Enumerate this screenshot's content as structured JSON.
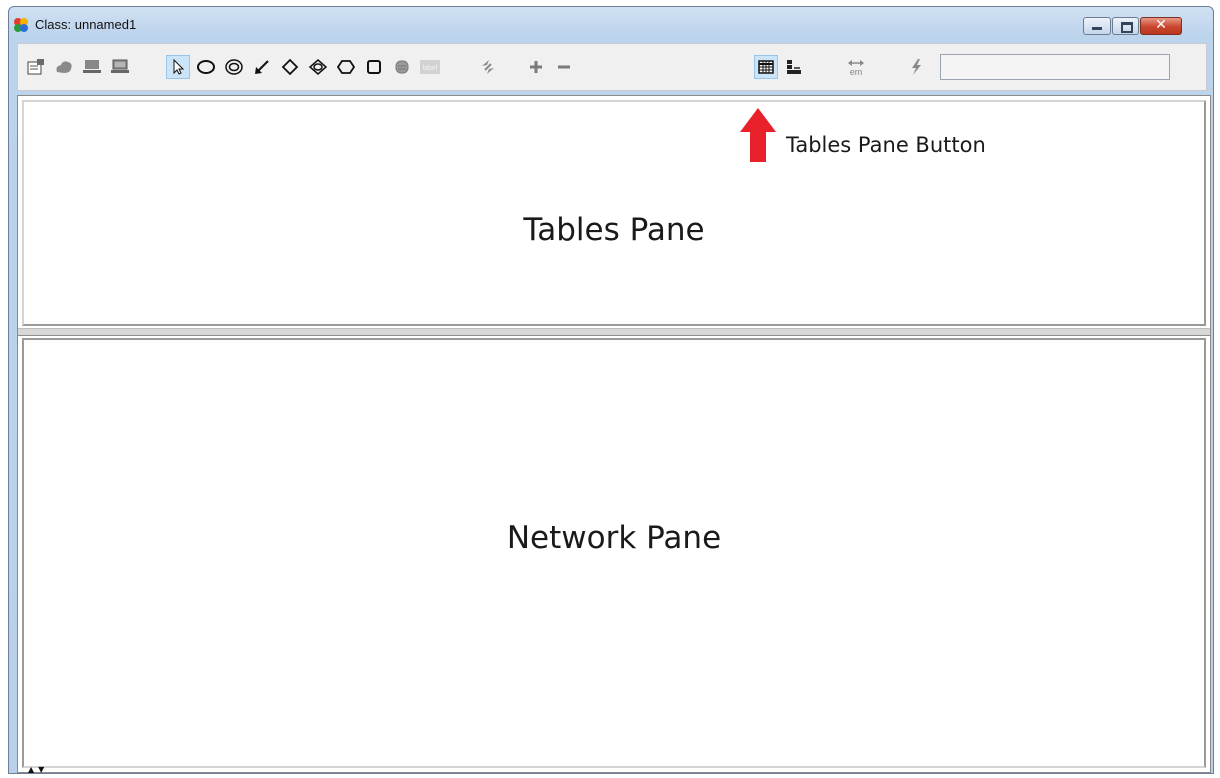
{
  "window": {
    "title": "Class: unnamed1",
    "close_glyph": "✕"
  },
  "toolbar": {
    "buttons": [
      {
        "icon": "properties-icon",
        "active": false
      },
      {
        "icon": "cloud-icon",
        "active": false
      },
      {
        "icon": "computer-icon",
        "active": false
      },
      {
        "icon": "computer-alt-icon",
        "active": false
      },
      {
        "icon": "pointer-icon",
        "active": true
      },
      {
        "icon": "ellipse-icon",
        "active": false
      },
      {
        "icon": "double-ellipse-icon",
        "active": false
      },
      {
        "icon": "arrow-tool-icon",
        "active": false
      },
      {
        "icon": "diamond-icon",
        "active": false
      },
      {
        "icon": "double-diamond-icon",
        "active": false
      },
      {
        "icon": "hexagon-icon",
        "active": false
      },
      {
        "icon": "rectangle-icon",
        "active": false
      },
      {
        "icon": "database-icon",
        "active": false
      },
      {
        "icon": "label-tool-icon",
        "active": false,
        "label": "label"
      },
      {
        "icon": "swap-icon",
        "active": false
      },
      {
        "icon": "plus-icon",
        "active": false
      },
      {
        "icon": "minus-icon",
        "active": false
      },
      {
        "icon": "tables-pane-icon",
        "active": true
      },
      {
        "icon": "network-pane-icon",
        "active": false
      },
      {
        "icon": "em-arrows-icon",
        "active": false,
        "label": "em"
      },
      {
        "icon": "lightning-icon",
        "active": false
      }
    ],
    "field_value": ""
  },
  "panes": {
    "tables_label": "Tables Pane",
    "network_label": "Network Pane"
  },
  "annotation": {
    "text": "Tables Pane Button",
    "arrow_color": "#e8212a"
  },
  "scroll": {
    "arrows": "▲▼"
  },
  "colors": {
    "active_button": "#cce4f7",
    "frame": "#b9d0ea",
    "close_button": "#c9452e"
  }
}
